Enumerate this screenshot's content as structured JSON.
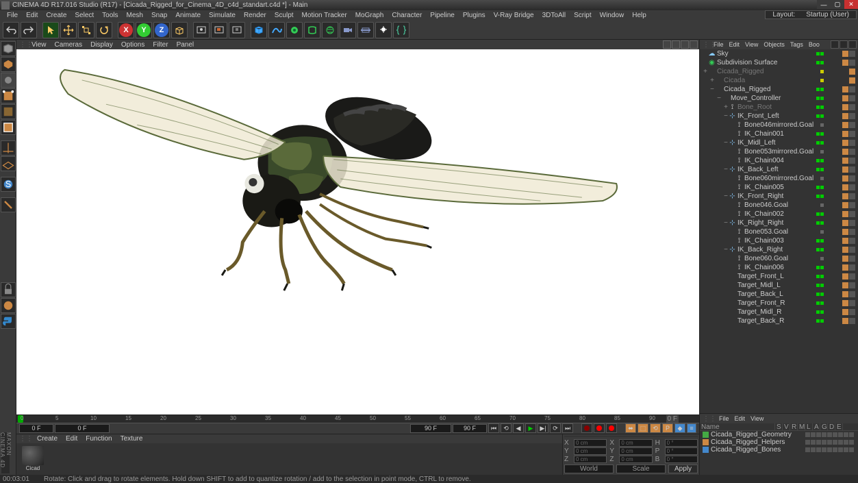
{
  "app": {
    "title": "CINEMA 4D R17.016 Studio (R17) - [Cicada_Rigged_for_Cinema_4D_c4d_standart.c4d *] - Main",
    "brand": "MAXON CINEMA 4D"
  },
  "mainmenu": {
    "items": [
      "File",
      "Edit",
      "Create",
      "Select",
      "Tools",
      "Mesh",
      "Snap",
      "Animate",
      "Simulate",
      "Render",
      "Sculpt",
      "Motion Tracker",
      "MoGraph",
      "Character",
      "Pipeline",
      "Plugins",
      "V-Ray Bridge",
      "3DToAll",
      "Script",
      "Window",
      "Help"
    ],
    "layout_prefix": "Layout:",
    "layout_value": "Startup (User)"
  },
  "viewmenu": {
    "items": [
      "View",
      "Cameras",
      "Display",
      "Options",
      "Filter",
      "Panel"
    ]
  },
  "timeline": {
    "ticks": [
      "0",
      "5",
      "10",
      "15",
      "20",
      "25",
      "30",
      "35",
      "40",
      "45",
      "50",
      "55",
      "60",
      "65",
      "70",
      "75",
      "80",
      "85",
      "90"
    ],
    "start": "0 F",
    "end": "90 F",
    "curframe": "0 F",
    "endcell": "0 F"
  },
  "material": {
    "menu": [
      "Create",
      "Edit",
      "Function",
      "Texture"
    ],
    "name": "Cicad"
  },
  "coords": {
    "rows": [
      {
        "axis": "X",
        "pos": "0 cm",
        "axis2": "X",
        "size": "0 cm",
        "axis3": "H",
        "rot": "0 °"
      },
      {
        "axis": "Y",
        "pos": "0 cm",
        "axis2": "Y",
        "size": "0 cm",
        "axis3": "P",
        "rot": "0 °"
      },
      {
        "axis": "Z",
        "pos": "0 cm",
        "axis2": "Z",
        "size": "0 cm",
        "axis3": "B",
        "rot": "0 °"
      }
    ],
    "world": "World",
    "scale": "Scale",
    "apply": "Apply"
  },
  "objmgr": {
    "menu": [
      "File",
      "Edit",
      "View",
      "Objects",
      "Tags",
      "Boo"
    ],
    "items": [
      {
        "depth": 0,
        "exp": "",
        "icon": "sky",
        "name": "Sky",
        "dots": [
          "g",
          "g"
        ],
        "tags": 1
      },
      {
        "depth": 0,
        "exp": "",
        "icon": "subs",
        "name": "Subdivision Surface",
        "dots": [
          "g",
          "g"
        ],
        "tags": 1,
        "sel": false
      },
      {
        "depth": 0,
        "exp": "+",
        "icon": "null",
        "name": "Cicada_Rigged",
        "dots": [
          "y"
        ],
        "tags": 0,
        "dim": true
      },
      {
        "depth": 1,
        "exp": "+",
        "icon": "null",
        "name": "Cicada",
        "dots": [
          "y"
        ],
        "tags": 0,
        "dim": true
      },
      {
        "depth": 1,
        "exp": "−",
        "icon": "null",
        "name": "Cicada_Rigged",
        "dots": [
          "g",
          "g"
        ],
        "tags": 1
      },
      {
        "depth": 2,
        "exp": "−",
        "icon": "null",
        "name": "Move_Controller",
        "dots": [
          "g",
          "g"
        ],
        "tags": 1
      },
      {
        "depth": 3,
        "exp": "+",
        "icon": "bone",
        "name": "Bone_Root",
        "dots": [
          "g",
          "g"
        ],
        "tags": 1,
        "dim": true
      },
      {
        "depth": 3,
        "exp": "−",
        "icon": "ik",
        "name": "IK_Front_Left",
        "dots": [
          "g",
          "g"
        ],
        "tags": 1
      },
      {
        "depth": 4,
        "exp": "",
        "icon": "bone",
        "name": "Bone046mirrored.Goal",
        "dots": [
          "gray"
        ],
        "tags": 1
      },
      {
        "depth": 4,
        "exp": "",
        "icon": "bone",
        "name": "IK_Chain001",
        "dots": [
          "g",
          "g"
        ],
        "tags": 1
      },
      {
        "depth": 3,
        "exp": "−",
        "icon": "ik",
        "name": "IK_Midl_Left",
        "dots": [
          "g",
          "g"
        ],
        "tags": 1
      },
      {
        "depth": 4,
        "exp": "",
        "icon": "bone",
        "name": "Bone053mirrored.Goal",
        "dots": [
          "gray"
        ],
        "tags": 1
      },
      {
        "depth": 4,
        "exp": "",
        "icon": "bone",
        "name": "IK_Chain004",
        "dots": [
          "g",
          "g"
        ],
        "tags": 1
      },
      {
        "depth": 3,
        "exp": "−",
        "icon": "ik",
        "name": "IK_Back_Left",
        "dots": [
          "g",
          "g"
        ],
        "tags": 1
      },
      {
        "depth": 4,
        "exp": "",
        "icon": "bone",
        "name": "Bone060mirrored.Goal",
        "dots": [
          "gray"
        ],
        "tags": 1
      },
      {
        "depth": 4,
        "exp": "",
        "icon": "bone",
        "name": "IK_Chain005",
        "dots": [
          "g",
          "g"
        ],
        "tags": 1
      },
      {
        "depth": 3,
        "exp": "−",
        "icon": "ik",
        "name": "IK_Front_Right",
        "dots": [
          "g",
          "g"
        ],
        "tags": 1
      },
      {
        "depth": 4,
        "exp": "",
        "icon": "bone",
        "name": "Bone046.Goal",
        "dots": [
          "gray"
        ],
        "tags": 1
      },
      {
        "depth": 4,
        "exp": "",
        "icon": "bone",
        "name": "IK_Chain002",
        "dots": [
          "g",
          "g"
        ],
        "tags": 1
      },
      {
        "depth": 3,
        "exp": "−",
        "icon": "ik",
        "name": "IK_Right_Right",
        "dots": [
          "g",
          "g"
        ],
        "tags": 1
      },
      {
        "depth": 4,
        "exp": "",
        "icon": "bone",
        "name": "Bone053.Goal",
        "dots": [
          "gray"
        ],
        "tags": 1
      },
      {
        "depth": 4,
        "exp": "",
        "icon": "bone",
        "name": "IK_Chain003",
        "dots": [
          "g",
          "g"
        ],
        "tags": 1
      },
      {
        "depth": 3,
        "exp": "−",
        "icon": "ik",
        "name": "IK_Back_Right",
        "dots": [
          "g",
          "g"
        ],
        "tags": 1
      },
      {
        "depth": 4,
        "exp": "",
        "icon": "bone",
        "name": "Bone060.Goal",
        "dots": [
          "gray"
        ],
        "tags": 1
      },
      {
        "depth": 4,
        "exp": "",
        "icon": "bone",
        "name": "IK_Chain006",
        "dots": [
          "g",
          "g"
        ],
        "tags": 1
      },
      {
        "depth": 3,
        "exp": "",
        "icon": "null",
        "name": "Target_Front_L",
        "dots": [
          "g",
          "g"
        ],
        "tags": 1
      },
      {
        "depth": 3,
        "exp": "",
        "icon": "null",
        "name": "Target_Midl_L",
        "dots": [
          "g",
          "g"
        ],
        "tags": 1
      },
      {
        "depth": 3,
        "exp": "",
        "icon": "null",
        "name": "Target_Back_L",
        "dots": [
          "g",
          "g"
        ],
        "tags": 1
      },
      {
        "depth": 3,
        "exp": "",
        "icon": "null",
        "name": "Target_Front_R",
        "dots": [
          "g",
          "g"
        ],
        "tags": 1
      },
      {
        "depth": 3,
        "exp": "",
        "icon": "null",
        "name": "Target_Midl_R",
        "dots": [
          "g",
          "g"
        ],
        "tags": 1
      },
      {
        "depth": 3,
        "exp": "",
        "icon": "null",
        "name": "Target_Back_R",
        "dots": [
          "g",
          "g"
        ],
        "tags": 1
      }
    ]
  },
  "layermgr": {
    "menu": [
      "File",
      "Edit",
      "View"
    ],
    "headers": [
      "Name",
      "S",
      "V",
      "R",
      "M",
      "L",
      "A",
      "G",
      "D",
      "E"
    ],
    "items": [
      {
        "color": "#4a4",
        "name": "Cicada_Rigged_Geometry"
      },
      {
        "color": "#c84",
        "name": "Cicada_Rigged_Helpers"
      },
      {
        "color": "#48c",
        "name": "Cicada_Rigged_Bones"
      }
    ]
  },
  "status": {
    "time": "00:03:01",
    "hint": "Rotate: Click and drag to rotate elements. Hold down SHIFT to add to quantize rotation / add to the selection in point mode, CTRL to remove."
  }
}
